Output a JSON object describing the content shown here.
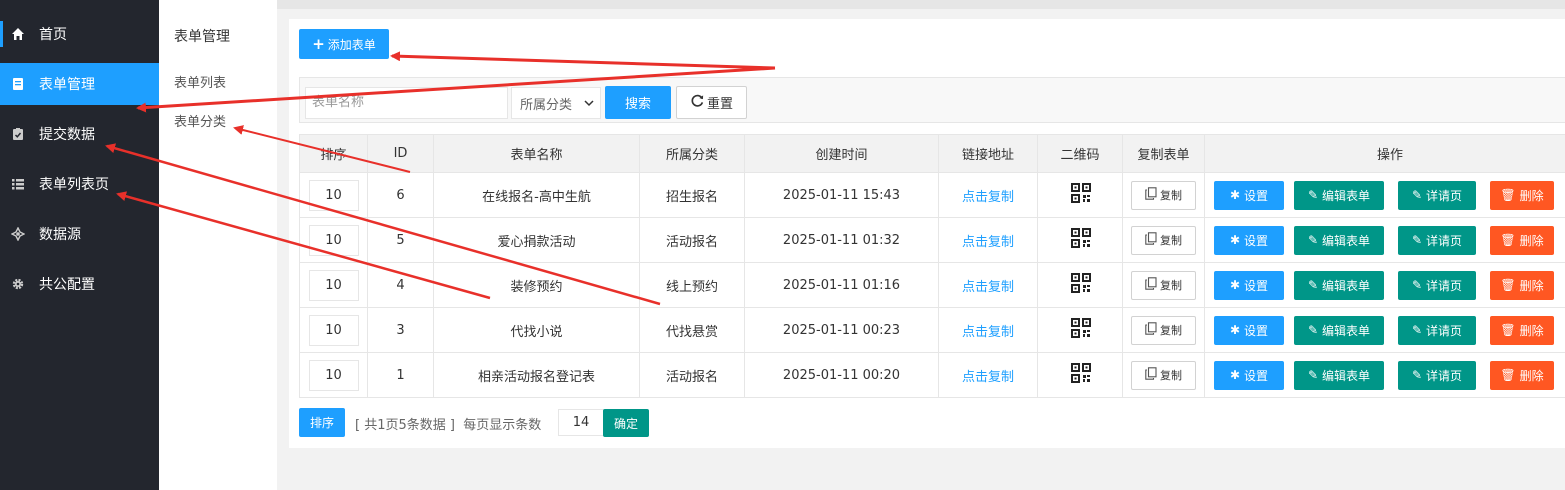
{
  "sidebar": {
    "items": [
      {
        "label": "首页",
        "icon": "home-icon"
      },
      {
        "label": "表单管理",
        "icon": "form-icon",
        "active": true
      },
      {
        "label": "提交数据",
        "icon": "clipboard-check-icon"
      },
      {
        "label": "表单列表页",
        "icon": "list-icon"
      },
      {
        "label": "数据源",
        "icon": "datasource-icon"
      },
      {
        "label": "共公配置",
        "icon": "gear-icon"
      }
    ]
  },
  "submenu": {
    "title": "表单管理",
    "items": [
      "表单列表",
      "表单分类"
    ]
  },
  "toolbar": {
    "add_label": "添加表单"
  },
  "search": {
    "placeholder": "表单名称",
    "category_selected": "所属分类",
    "search_label": "搜索",
    "reset_label": "重置"
  },
  "table": {
    "headers": [
      "排序",
      "ID",
      "表单名称",
      "所属分类",
      "创建时间",
      "链接地址",
      "二维码",
      "复制表单",
      "操作"
    ],
    "rows": [
      {
        "sort": "10",
        "id": "6",
        "name": "在线报名-高中生航",
        "category": "招生报名",
        "created": "2025-01-11 15:43",
        "link": "点击复制",
        "copy": "复制"
      },
      {
        "sort": "10",
        "id": "5",
        "name": "爱心捐款活动",
        "category": "活动报名",
        "created": "2025-01-11 01:32",
        "link": "点击复制",
        "copy": "复制"
      },
      {
        "sort": "10",
        "id": "4",
        "name": "装修预约",
        "category": "线上预约",
        "created": "2025-01-11 01:16",
        "link": "点击复制",
        "copy": "复制"
      },
      {
        "sort": "10",
        "id": "3",
        "name": "代找小说",
        "category": "代找悬赏",
        "created": "2025-01-11 00:23",
        "link": "点击复制",
        "copy": "复制"
      },
      {
        "sort": "10",
        "id": "1",
        "name": "相亲活动报名登记表",
        "category": "活动报名",
        "created": "2025-01-11 00:20",
        "link": "点击复制",
        "copy": "复制"
      }
    ],
    "actions": {
      "settings": "设置",
      "edit": "编辑表单",
      "detail": "详请页",
      "delete": "删除"
    }
  },
  "pager": {
    "sort_label": "排序",
    "summary": "[ 共1页5条数据 ]  每页显示条数",
    "per_page": "14",
    "confirm_label": "确定"
  },
  "colors": {
    "sidebar_bg": "#23262e",
    "active_blue": "#1e9fff",
    "green": "#009688",
    "orange": "#ff5722",
    "arrow_red": "#e8302a"
  }
}
